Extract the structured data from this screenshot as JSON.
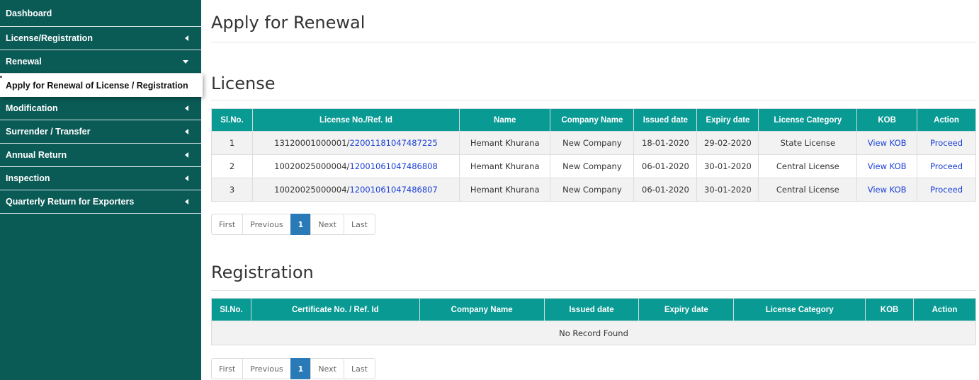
{
  "sidebar": {
    "items": [
      {
        "label": "Dashboard",
        "caret": "none"
      },
      {
        "label": "License/Registration",
        "caret": "left"
      },
      {
        "label": "Renewal",
        "caret": "down"
      },
      {
        "label": "Apply for Renewal of License / Registration",
        "caret": "sub"
      },
      {
        "label": "Modification",
        "caret": "left"
      },
      {
        "label": "Surrender / Transfer",
        "caret": "left"
      },
      {
        "label": "Annual Return",
        "caret": "left"
      },
      {
        "label": "Inspection",
        "caret": "left"
      },
      {
        "label": "Quarterly Return for Exporters",
        "caret": "left"
      }
    ]
  },
  "page": {
    "title": "Apply for Renewal"
  },
  "license": {
    "title": "License",
    "headers": [
      "Sl.No.",
      "License No./Ref. Id",
      "Name",
      "Company Name",
      "Issued date",
      "Expiry date",
      "License Category",
      "KOB",
      "Action"
    ],
    "rows": [
      {
        "sl": "1",
        "license_no": "13120001000001/",
        "ref_id": "22001181047487225",
        "name": "Hemant Khurana",
        "company": "New Company",
        "issued": "18-01-2020",
        "expiry": "29-02-2020",
        "category": "State License",
        "kob": "View KOB",
        "action": "Proceed"
      },
      {
        "sl": "2",
        "license_no": "10020025000004/",
        "ref_id": "12001061047486808",
        "name": "Hemant Khurana",
        "company": "New Company",
        "issued": "06-01-2020",
        "expiry": "30-01-2020",
        "category": "Central License",
        "kob": "View KOB",
        "action": "Proceed"
      },
      {
        "sl": "3",
        "license_no": "10020025000004/",
        "ref_id": "12001061047486807",
        "name": "Hemant Khurana",
        "company": "New Company",
        "issued": "06-01-2020",
        "expiry": "30-01-2020",
        "category": "Central License",
        "kob": "View KOB",
        "action": "Proceed"
      }
    ]
  },
  "registration": {
    "title": "Registration",
    "headers": [
      "Sl.No.",
      "Certificate No. / Ref. Id",
      "Company Name",
      "Issued date",
      "Expiry date",
      "License Category",
      "KOB",
      "Action"
    ],
    "empty_text": "No Record Found"
  },
  "pagination": {
    "first": "First",
    "previous": "Previous",
    "page": "1",
    "next": "Next",
    "last": "Last"
  },
  "colors": {
    "sidebar_bg": "#0a5a56",
    "table_header": "#0a9a94",
    "link": "#1a3fd6",
    "page_active": "#2a7ab8"
  }
}
